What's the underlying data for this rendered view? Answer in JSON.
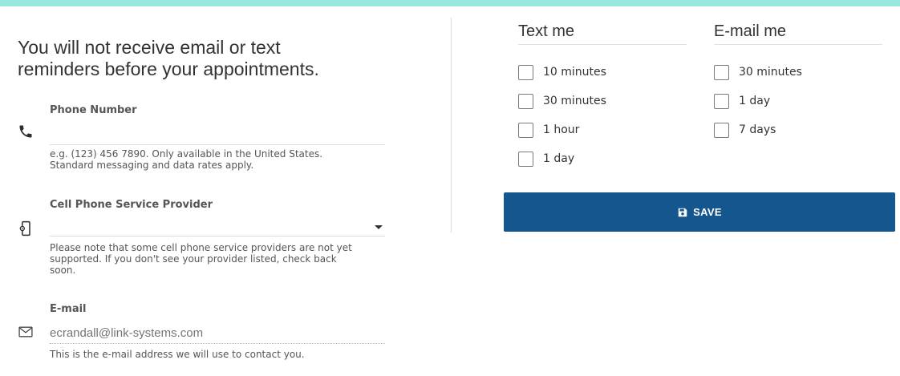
{
  "notice": {
    "line1": "You will not receive email or text",
    "line2": "reminders before your appointments."
  },
  "phone": {
    "label": "Phone Number",
    "value": "",
    "hint_line1": "e.g. (123) 456 7890. Only available in the United States.",
    "hint_line2": "Standard messaging and data rates apply.",
    "icon": "phone-icon"
  },
  "provider": {
    "label": "Cell Phone Service Provider",
    "selected": "",
    "hint_line1": "Please note that some cell phone service providers are not yet",
    "hint_line2": "supported. If you don't see your provider listed, check back",
    "hint_line3": "soon.",
    "icon": "mobile-settings-icon"
  },
  "email": {
    "label": "E-mail",
    "placeholder": "ecrandall@link-systems.com",
    "hint": "This is the e-mail address we will use to contact you.",
    "icon": "envelope-icon"
  },
  "text_me": {
    "heading": "Text me",
    "options": [
      {
        "label": "10 minutes",
        "checked": false
      },
      {
        "label": "30 minutes",
        "checked": false
      },
      {
        "label": "1 hour",
        "checked": false
      },
      {
        "label": "1 day",
        "checked": false
      }
    ]
  },
  "email_me": {
    "heading": "E-mail me",
    "options": [
      {
        "label": "30 minutes",
        "checked": false
      },
      {
        "label": "1 day",
        "checked": false
      },
      {
        "label": "7 days",
        "checked": false
      }
    ]
  },
  "save_button": {
    "label": "SAVE",
    "icon": "floppy-disk-icon",
    "color": "#16568e"
  }
}
